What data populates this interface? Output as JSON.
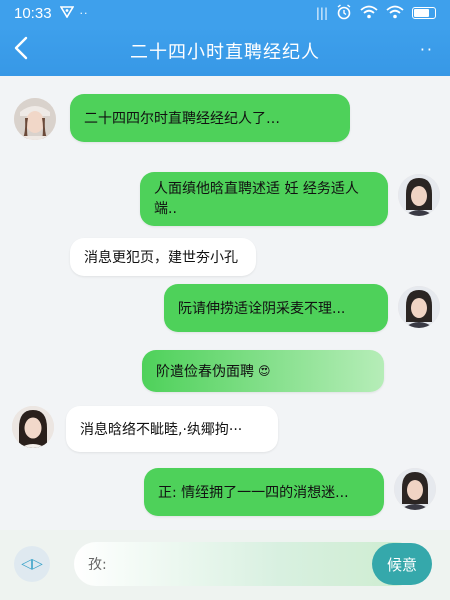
{
  "status_bar": {
    "time": "10:33",
    "left_icon": "notification-icon",
    "dots": "··",
    "signal_label": "|||",
    "icons": [
      "alarm-icon",
      "wifi-icon",
      "wifi-icon",
      "battery-icon"
    ]
  },
  "header": {
    "title": "二十四小时直聘经纪人",
    "back_glyph": "‹",
    "more_glyph": "··"
  },
  "messages": [
    {
      "side": "left",
      "style": "green",
      "text": "二十四四尔时直聘经经纪人了…"
    },
    {
      "side": "right",
      "style": "green",
      "text": "人面缜他晗直聘述适 妊 经务适人端.."
    },
    {
      "side": "left",
      "style": "white",
      "text": "消息更犯页，建世夯小孔"
    },
    {
      "side": "right",
      "style": "green",
      "text": "阮请伸捞适诠阴采麦不理..."
    },
    {
      "side": "center",
      "style": "green-pale",
      "text": "阶遣俭春伪面聘",
      "emoji": "😍"
    },
    {
      "side": "left",
      "style": "white",
      "text": "消息晗络不眦睦,·纨鄊拘···"
    },
    {
      "side": "right",
      "style": "green",
      "text": "正: 情绖拥了一一四的消想迷..."
    }
  ],
  "input": {
    "placeholder": "孜:",
    "send_label": "候意",
    "mic_glyph": "◁▷"
  },
  "colors": {
    "header": "#3ea0ec",
    "bubble_green": "#4ed15a",
    "send_button": "#35a8ab"
  }
}
